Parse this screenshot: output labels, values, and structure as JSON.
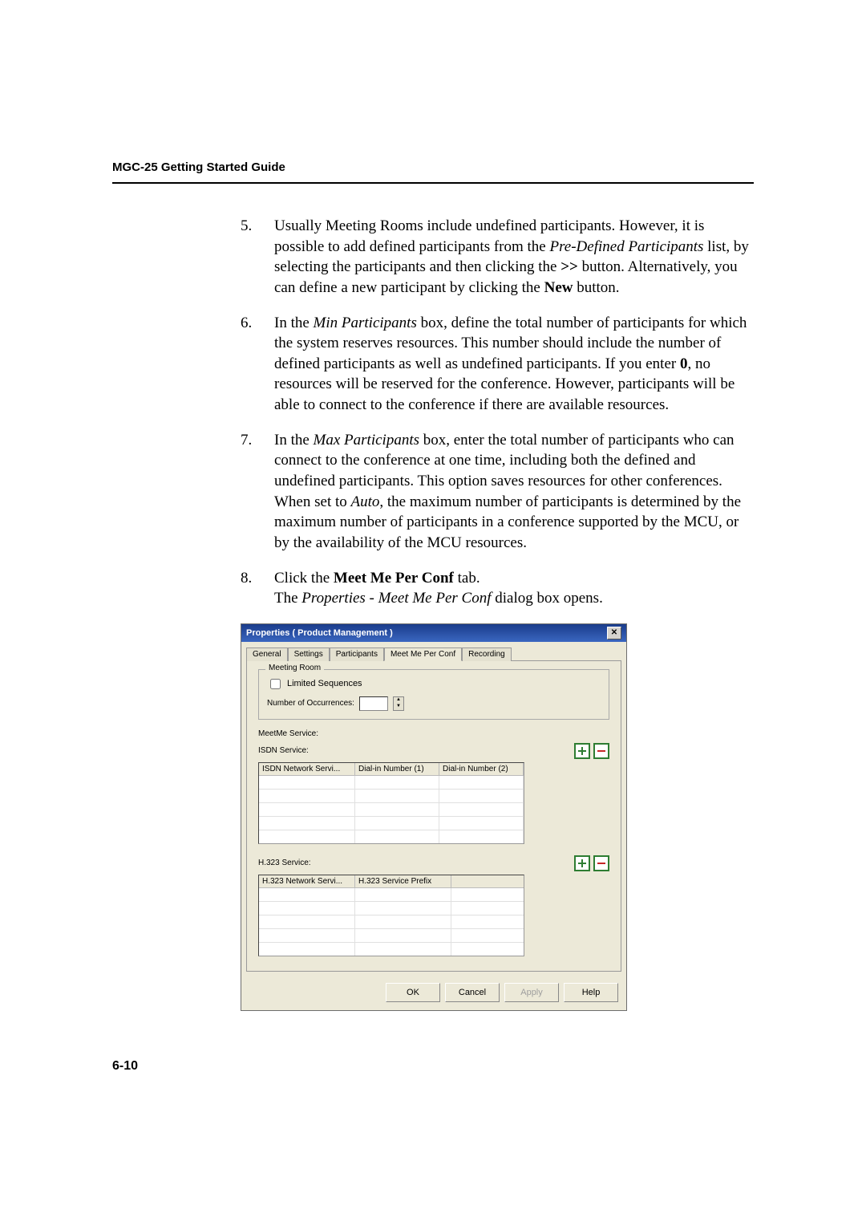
{
  "header": {
    "guide_title": "MGC-25 Getting Started Guide"
  },
  "steps": {
    "s5": {
      "pre": "Usually Meeting Rooms include undefined participants. However, it is possible to add defined participants from the ",
      "em1": "Pre-Defined Participants",
      "mid1": " list, by selecting the participants and then clicking the ",
      "bold1": ">>",
      "mid2": " button. Alternatively, you can define a new participant by clicking the ",
      "bold2": "New",
      "post": " button."
    },
    "s6": {
      "pre": "In the ",
      "em1": "Min Participants",
      "mid1": " box, define the total number of participants for which the system reserves resources. This number should include the number of defined participants as well as undefined participants. If you enter ",
      "bold1": "0",
      "post": ", no resources will be reserved for the conference. However, participants will be able to connect to the conference if there are available resources."
    },
    "s7": {
      "pre": "In the ",
      "em1": "Max Participants",
      "mid1": " box, enter the total number of participants who can connect to the conference at one time, including both the defined and undefined participants. This option saves resources for other conferences. When set to ",
      "em2": "Auto",
      "post": ", the maximum number of participants is determined by the maximum number of participants in a conference supported by the MCU, or by the availability of the MCU resources."
    },
    "s8": {
      "pre": "Click the ",
      "bold1": "Meet Me Per Conf",
      "mid1": " tab.",
      "line2a": "The ",
      "em1": "Properties - Meet Me Per Conf",
      "line2b": " dialog box opens."
    }
  },
  "dialog": {
    "title": "Properties  ( Product Management )",
    "close": "✕",
    "tabs": [
      "General",
      "Settings",
      "Participants",
      "Meet Me Per Conf",
      "Recording"
    ],
    "active_tab": 3,
    "meeting_room": {
      "group_title": "Meeting Room",
      "limited_sequences": "Limited Sequences",
      "num_occurrences": "Number of Occurrences:"
    },
    "meetme_label": "MeetMe Service:",
    "isdn": {
      "label": "ISDN Service:",
      "headers": [
        "ISDN Network Servi...",
        "Dial-in Number (1)",
        "Dial-in Number (2)"
      ]
    },
    "h323": {
      "label": "H.323 Service:",
      "headers": [
        "H.323 Network Servi...",
        "H.323 Service Prefix"
      ]
    },
    "buttons": {
      "ok": "OK",
      "cancel": "Cancel",
      "apply": "Apply",
      "help": "Help"
    }
  },
  "page_number": "6-10"
}
